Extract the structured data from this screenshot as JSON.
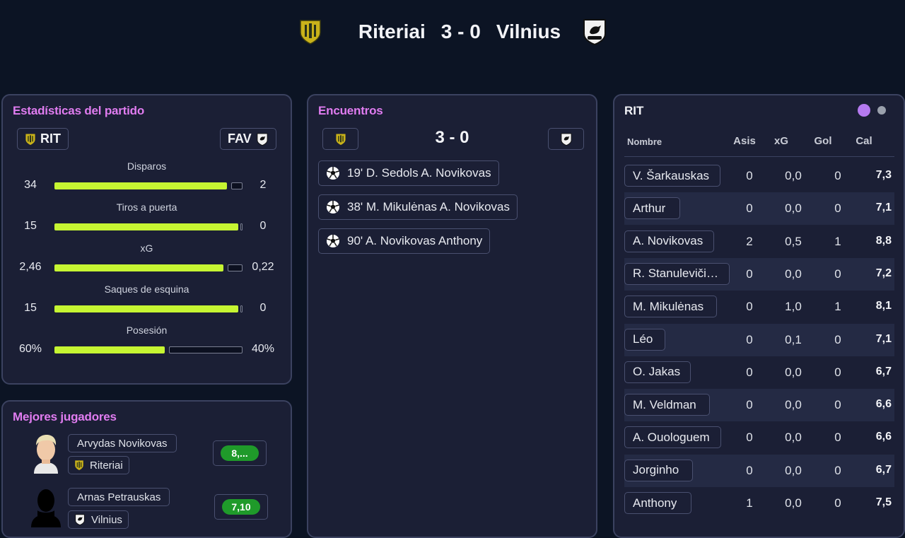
{
  "header": {
    "home_team": "Riteriai",
    "away_team": "Vilnius",
    "score": "3 - 0"
  },
  "stats": {
    "title": "Estadísticas del partido",
    "home_code": "RIT",
    "away_code": "FAV",
    "colors": {
      "home_bar": "#c6f532",
      "away_bar": "#0c1020"
    },
    "items": [
      {
        "label": "Disparos",
        "home": "34",
        "away": "2",
        "home_share": 0.94
      },
      {
        "label": "Tiros a puerta",
        "home": "15",
        "away": "0",
        "home_share": 1.0
      },
      {
        "label": "xG",
        "home": "2,46",
        "away": "0,22",
        "home_share": 0.92
      },
      {
        "label": "Saques de esquina",
        "home": "15",
        "away": "0",
        "home_share": 1.0
      },
      {
        "label": "Posesión",
        "home": "60%",
        "away": "40%",
        "home_share": 0.6
      }
    ]
  },
  "best_players": {
    "title": "Mejores jugadores",
    "players": [
      {
        "name": "Arvydas Novikovas",
        "club": "Riteriai",
        "rating": "8,..."
      },
      {
        "name": "Arnas Petrauskas",
        "club": "Vilnius",
        "rating": "7,10"
      }
    ]
  },
  "events": {
    "title": "Encuentros",
    "score": "3 - 0",
    "items": [
      {
        "text": "19'  D. Sedols  A. Novikovas",
        "icon": "soccer-ball-icon"
      },
      {
        "text": "38'  M. Mikulėnas  A. Novikovas",
        "icon": "soccer-ball-icon"
      },
      {
        "text": "90'  A. Novikovas  Anthony",
        "icon": "soccer-ball-icon"
      }
    ]
  },
  "ratings": {
    "team": "RIT",
    "indicator_colors": {
      "active": "#b57af0",
      "inactive": "#9aa0ac"
    },
    "columns": {
      "name": "Nombre",
      "assists": "Asis",
      "xg": "xG",
      "goals": "Gol",
      "rating": "Cal"
    },
    "rows": [
      {
        "name": "V. Šarkauskas",
        "assists": "0",
        "xg": "0,0",
        "goals": "0",
        "rating": "7,3"
      },
      {
        "name": "Arthur",
        "assists": "0",
        "xg": "0,0",
        "goals": "0",
        "rating": "7,1"
      },
      {
        "name": "A. Novikovas",
        "assists": "2",
        "xg": "0,5",
        "goals": "1",
        "rating": "8,8"
      },
      {
        "name": "R. Stanulevičių...",
        "assists": "0",
        "xg": "0,0",
        "goals": "0",
        "rating": "7,2"
      },
      {
        "name": "M. Mikulėnas",
        "assists": "0",
        "xg": "1,0",
        "goals": "1",
        "rating": "8,1"
      },
      {
        "name": "Léo",
        "assists": "0",
        "xg": "0,1",
        "goals": "0",
        "rating": "7,1"
      },
      {
        "name": "O. Jakas",
        "assists": "0",
        "xg": "0,0",
        "goals": "0",
        "rating": "6,7"
      },
      {
        "name": "M. Veldman",
        "assists": "0",
        "xg": "0,0",
        "goals": "0",
        "rating": "6,6"
      },
      {
        "name": "A. Ouologuem",
        "assists": "0",
        "xg": "0,0",
        "goals": "0",
        "rating": "6,6"
      },
      {
        "name": "Jorginho",
        "assists": "0",
        "xg": "0,0",
        "goals": "0",
        "rating": "6,7"
      },
      {
        "name": "Anthony",
        "assists": "1",
        "xg": "0,0",
        "goals": "0",
        "rating": "7,5"
      }
    ]
  }
}
